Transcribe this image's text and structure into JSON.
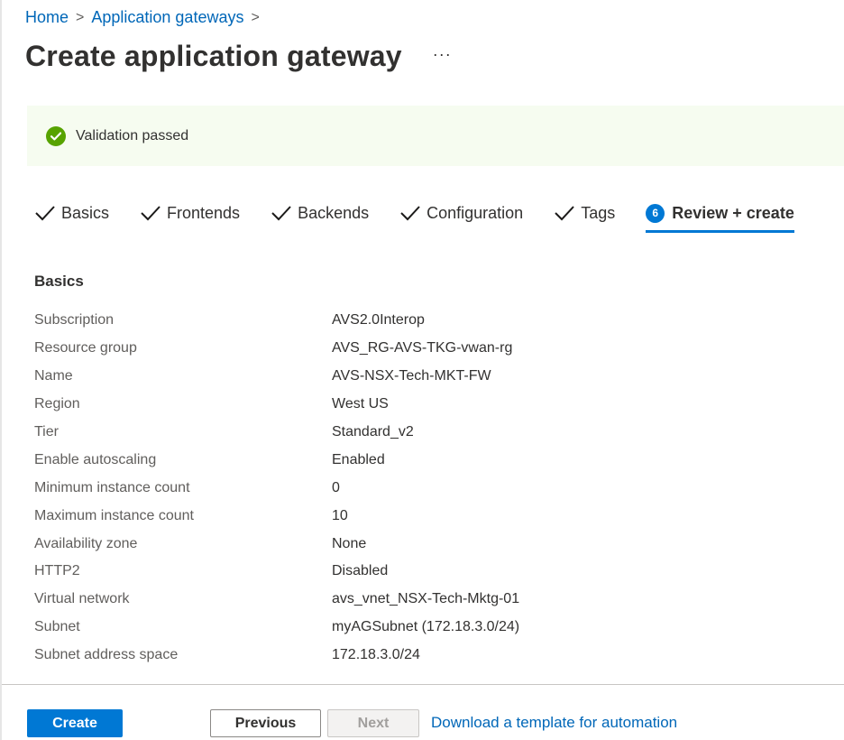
{
  "breadcrumb": {
    "items": [
      {
        "label": "Home"
      },
      {
        "label": "Application gateways"
      }
    ],
    "separator": ">"
  },
  "header": {
    "title": "Create application gateway",
    "more_label": "···"
  },
  "banner": {
    "icon": "check-circle-icon",
    "text": "Validation passed",
    "status_color": "#57a300"
  },
  "tabs": [
    {
      "label": "Basics",
      "state": "completed",
      "icon": "checkmark-icon"
    },
    {
      "label": "Frontends",
      "state": "completed",
      "icon": "checkmark-icon"
    },
    {
      "label": "Backends",
      "state": "completed",
      "icon": "checkmark-icon"
    },
    {
      "label": "Configuration",
      "state": "completed",
      "icon": "checkmark-icon"
    },
    {
      "label": "Tags",
      "state": "completed",
      "icon": "checkmark-icon"
    },
    {
      "label": "Review + create",
      "state": "active",
      "step": "6"
    }
  ],
  "section": {
    "title": "Basics",
    "rows": [
      {
        "label": "Subscription",
        "value": "AVS2.0Interop"
      },
      {
        "label": "Resource group",
        "value": "AVS_RG-AVS-TKG-vwan-rg"
      },
      {
        "label": "Name",
        "value": "AVS-NSX-Tech-MKT-FW"
      },
      {
        "label": "Region",
        "value": "West US"
      },
      {
        "label": "Tier",
        "value": "Standard_v2"
      },
      {
        "label": "Enable autoscaling",
        "value": "Enabled"
      },
      {
        "label": "Minimum instance count",
        "value": "0"
      },
      {
        "label": "Maximum instance count",
        "value": "10"
      },
      {
        "label": "Availability zone",
        "value": "None"
      },
      {
        "label": "HTTP2",
        "value": "Disabled"
      },
      {
        "label": "Virtual network",
        "value": "avs_vnet_NSX-Tech-Mktg-01"
      },
      {
        "label": "Subnet",
        "value": "myAGSubnet (172.18.3.0/24)"
      },
      {
        "label": "Subnet address space",
        "value": "172.18.3.0/24"
      }
    ]
  },
  "footer": {
    "create_label": "Create",
    "previous_label": "Previous",
    "next_label": "Next",
    "next_disabled": true,
    "download_link_label": "Download a template for automation"
  },
  "colors": {
    "accent": "#0078d4",
    "link": "#0067b8",
    "success": "#57a300",
    "banner_bg": "#f6fcf0"
  }
}
